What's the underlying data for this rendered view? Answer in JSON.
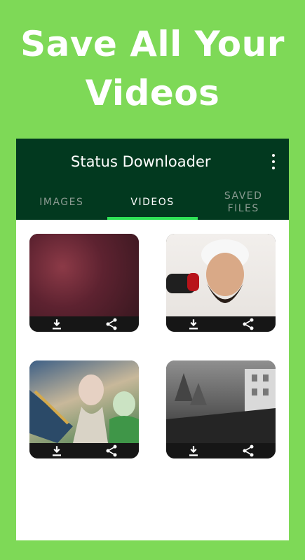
{
  "promo": {
    "line1": "Save All Your",
    "line2": "Videos"
  },
  "appbar": {
    "title": "Status Downloader"
  },
  "tabs": [
    {
      "label": "IMAGES",
      "active": false
    },
    {
      "label": "VIDEOS",
      "active": true
    },
    {
      "label": "SAVED\nFILES",
      "active": false
    }
  ],
  "videos": [
    {
      "id": "video-1",
      "actions": [
        "download-icon",
        "share-icon"
      ]
    },
    {
      "id": "video-2",
      "actions": [
        "download-icon",
        "share-icon"
      ]
    },
    {
      "id": "video-3",
      "actions": [
        "download-icon",
        "share-icon"
      ]
    },
    {
      "id": "video-4",
      "actions": [
        "download-icon",
        "share-icon"
      ]
    }
  ],
  "colors": {
    "background": "#7ed957",
    "appbar": "#02391f",
    "tab_indicator": "#2ee356"
  }
}
